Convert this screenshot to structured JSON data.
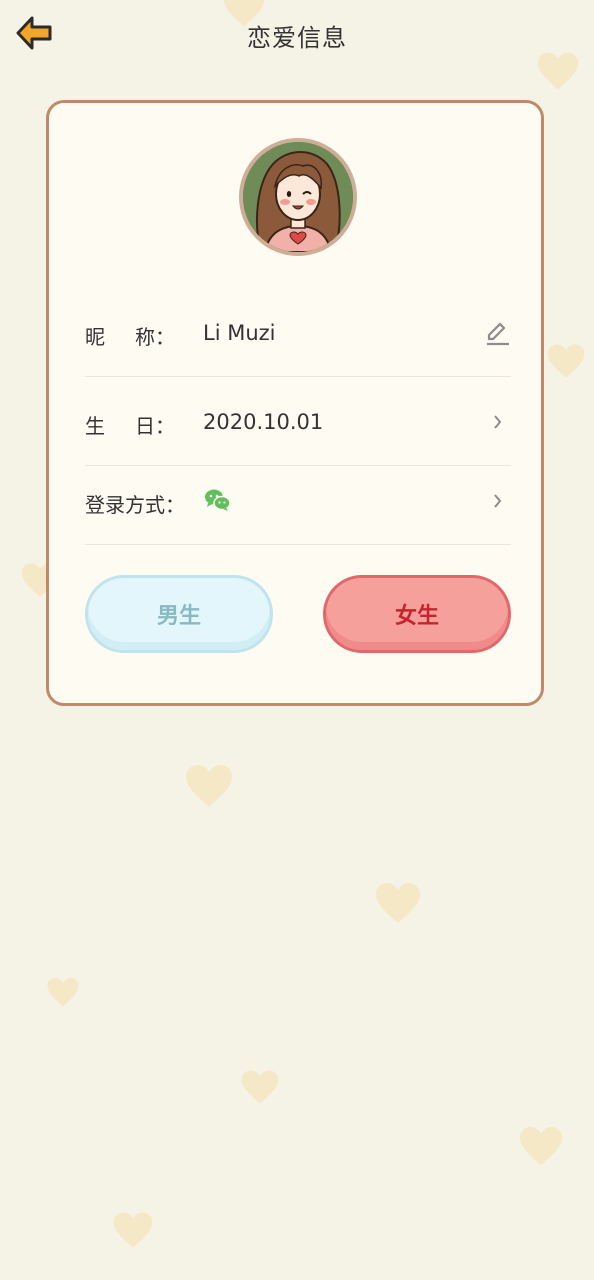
{
  "header": {
    "title": "恋爱信息",
    "back_icon": "arrow-left-icon"
  },
  "profile": {
    "avatar_icon": "girl-avatar",
    "rows": {
      "nickname": {
        "label_a": "昵",
        "label_b": "称：",
        "value": "Li Muzi",
        "icon": "pencil-icon"
      },
      "birthday": {
        "label_a": "生",
        "label_b": "日：",
        "value": "2020.10.01",
        "icon": "chevron-right-icon"
      },
      "login": {
        "label": "登录方式：",
        "value_icon": "wechat-icon",
        "icon": "chevron-right-icon"
      }
    }
  },
  "gender": {
    "male_label": "男生",
    "female_label": "女生",
    "selected": "female"
  },
  "colors": {
    "background": "#f5f2e6",
    "card_border": "#c08a68",
    "back_arrow": "#f2a52b",
    "wechat": "#5fc05c",
    "male_button": "#e3f6fb",
    "female_button": "#f6a09c"
  }
}
